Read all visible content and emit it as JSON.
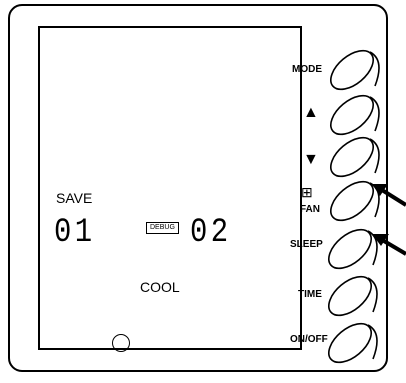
{
  "screen": {
    "save_label": "SAVE",
    "left_digits": "01",
    "debug_badge": "DEBUG",
    "right_digits": "02",
    "mode_text": "COOL"
  },
  "buttons": [
    {
      "id": "mode",
      "label": "MODE"
    },
    {
      "id": "up",
      "label": "▲"
    },
    {
      "id": "down",
      "label": "▼"
    },
    {
      "id": "fan",
      "label": "FAN"
    },
    {
      "id": "sleep",
      "label": "SLEEP"
    },
    {
      "id": "time",
      "label": "TIME"
    },
    {
      "id": "onoff",
      "label": "ON/OFF"
    }
  ],
  "annotations": {
    "arrows_pointing_to": [
      "fan",
      "sleep"
    ]
  }
}
